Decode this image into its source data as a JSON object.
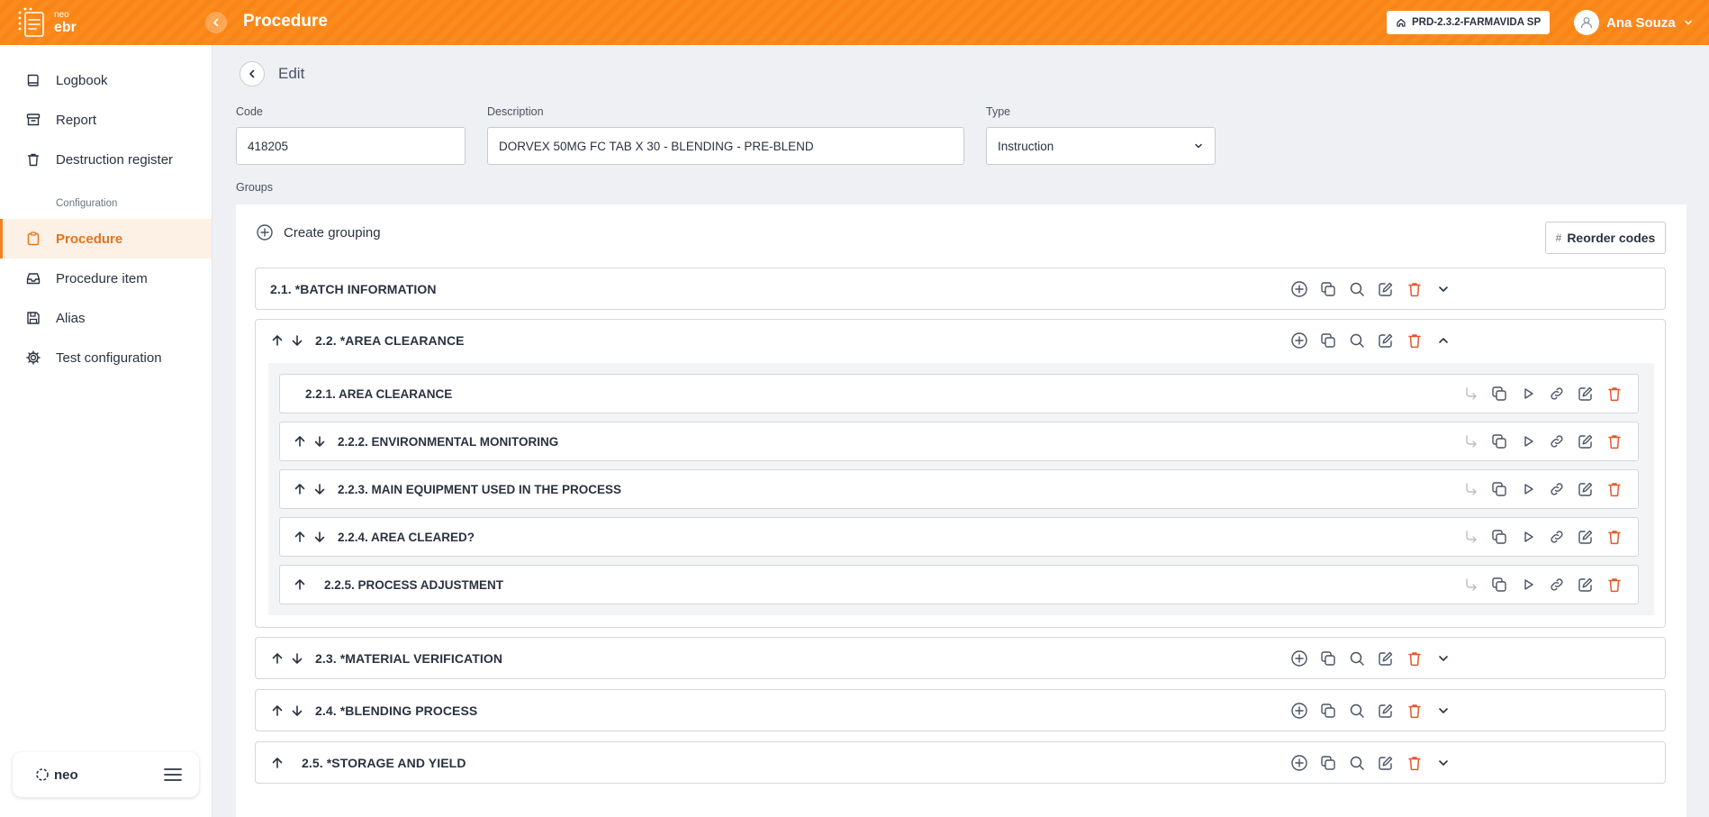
{
  "header": {
    "logo_small": "neo",
    "logo_big": "ebr",
    "title": "Procedure",
    "environment": "PRD-2.3.2-FARMAVIDA SP",
    "user_name": "Ana Souza"
  },
  "sidebar": {
    "items": [
      {
        "label": "Logbook",
        "icon": "book-icon"
      },
      {
        "label": "Report",
        "icon": "archive-icon"
      },
      {
        "label": "Destruction register",
        "icon": "trash-icon"
      }
    ],
    "section": "Configuration",
    "config_items": [
      {
        "label": "Procedure",
        "icon": "clipboard-icon",
        "active": true
      },
      {
        "label": "Procedure item",
        "icon": "inbox-icon"
      },
      {
        "label": "Alias",
        "icon": "save-icon"
      },
      {
        "label": "Test configuration",
        "icon": "gear-icon"
      }
    ],
    "brand": "neo"
  },
  "form": {
    "edit_label": "Edit",
    "code_label": "Code",
    "code_value": "418205",
    "description_label": "Description",
    "description_value": "DORVEX 50MG FC TAB X 30 - BLENDING - PRE-BLEND",
    "type_label": "Type",
    "type_value": "Instruction",
    "groups_label": "Groups"
  },
  "groups": {
    "create_label": "Create grouping",
    "reorder_label": "Reorder codes",
    "list": [
      {
        "title": "2.1. *BATCH INFORMATION",
        "expanded": false
      },
      {
        "title": "2.2. *AREA CLEARANCE",
        "expanded": true,
        "items": [
          "2.2.1. AREA CLEARANCE",
          "2.2.2. ENVIRONMENTAL MONITORING",
          "2.2.3. MAIN EQUIPMENT USED IN THE PROCESS",
          "2.2.4. AREA CLEARED?",
          "2.2.5. PROCESS ADJUSTMENT"
        ]
      },
      {
        "title": "2.3. *MATERIAL VERIFICATION",
        "expanded": false
      },
      {
        "title": "2.4. *BLENDING PROCESS",
        "expanded": false
      },
      {
        "title": "2.5. *STORAGE AND YIELD",
        "expanded": false
      }
    ]
  },
  "colors": {
    "accent": "#f58220",
    "danger": "#e4572e",
    "text": "#2a3240"
  }
}
